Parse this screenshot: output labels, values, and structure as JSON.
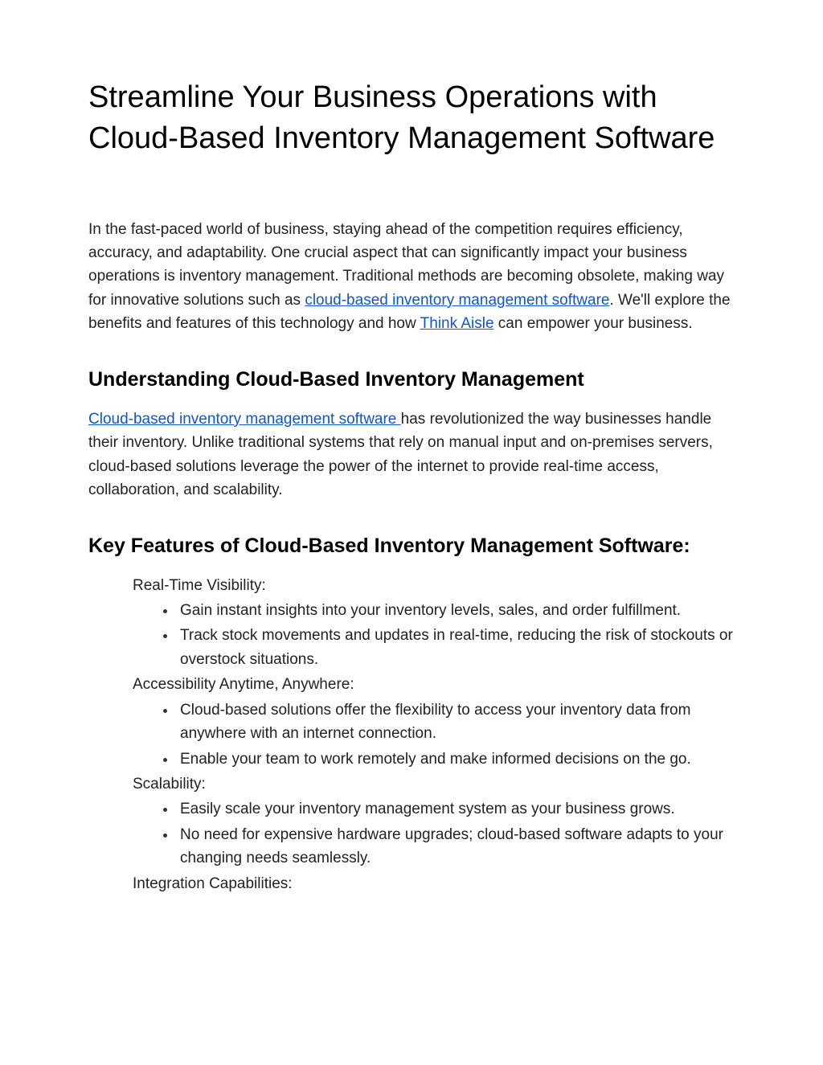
{
  "title": "Streamline Your Business Operations with Cloud-Based Inventory Management Software",
  "intro": {
    "part1": "In the fast-paced world of business, staying ahead of the competition requires efficiency, accuracy, and adaptability. One crucial aspect that can significantly impact your business operations is inventory management. Traditional methods are becoming obsolete, making way for innovative solutions such as ",
    "link1": "cloud-based inventory management software",
    "part2": ". We'll explore the benefits and features of this technology and how ",
    "link2": "Think Aisle",
    "part3": " can empower your business."
  },
  "section1": {
    "heading": "Understanding Cloud-Based Inventory Management",
    "link": "Cloud-based inventory management software ",
    "body": "has revolutionized the way businesses handle their inventory. Unlike traditional systems that rely on manual input and on-premises servers, cloud-based solutions leverage the power of the internet to provide real-time access, collaboration, and scalability."
  },
  "section2": {
    "heading": "Key Features of Cloud-Based Inventory Management Software:",
    "features": [
      {
        "title": "Real-Time Visibility:",
        "items": [
          "Gain instant insights into your inventory levels, sales, and order fulfillment.",
          "Track stock movements and updates in real-time, reducing the risk of stockouts or overstock situations."
        ]
      },
      {
        "title": "Accessibility Anytime, Anywhere:",
        "items": [
          "Cloud-based solutions offer the flexibility to access your inventory data from anywhere with an internet connection.",
          "Enable your team to work remotely and make informed decisions on the go."
        ]
      },
      {
        "title": "Scalability:",
        "items": [
          "Easily scale your inventory management system as your business grows.",
          "No need for expensive hardware upgrades; cloud-based software adapts to your changing needs seamlessly."
        ]
      },
      {
        "title": "Integration Capabilities:",
        "items": []
      }
    ]
  }
}
